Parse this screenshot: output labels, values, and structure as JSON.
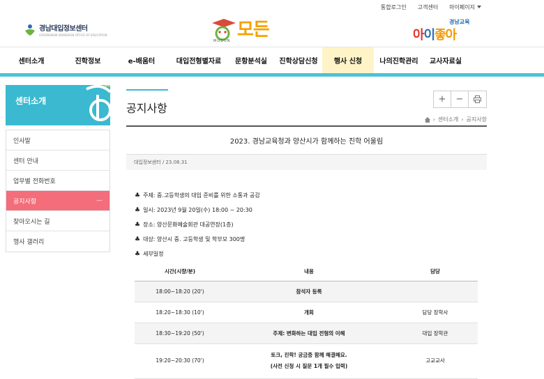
{
  "topbar": {
    "links": [
      "통합로그인",
      "고객센터",
      "마이페이지"
    ]
  },
  "header": {
    "left_logo": {
      "name": "경남대입정보센터",
      "sub": "GYEONGNAM ADMISSION OFFICE OF EDUCATION"
    },
    "center_logo": {
      "brand": "모든",
      "en": "MODUN"
    },
    "right_logo": {
      "small": "경남교육",
      "big_1": "아",
      "big_2": "이",
      "big_3": "좋아"
    }
  },
  "nav": {
    "items": [
      "센터소개",
      "진학정보",
      "e-배움터",
      "대입전형별자료",
      "문항분석실",
      "진학상담신청",
      "행사 신청",
      "나의진학관리",
      "교사자료실"
    ],
    "active_index": 6
  },
  "sidebar": {
    "title": "센터소개",
    "items": [
      "인사말",
      "센터 안내",
      "업무별 전화번호",
      "공지사항",
      "찾아오시는 길",
      "행사 갤러리"
    ],
    "active_index": 3,
    "active_marker": "—"
  },
  "page": {
    "title": "공지사항",
    "tools": [
      "+",
      "−",
      "⎙"
    ],
    "breadcrumb": [
      "센터소개",
      "공지사항"
    ]
  },
  "post": {
    "title": "2023. 경남교육청과 양산시가 함께하는 진학 어울림",
    "meta": "대입정보센터 / 23.08.31",
    "lines": [
      "주제: 중.고등학생의 대입 준비를 위한 소통과 공감",
      "일시: 2023년 9월 20일(수) 18:00 ~ 20:30",
      "장소: 양산문화예술회관 대공연장(1층)",
      "대상: 양산시 중. 고등학생 및 학부모 300명",
      "세부일정"
    ],
    "bullet": "♣"
  },
  "schedule": {
    "headers": [
      "시간(시량/분)",
      "내용",
      "담당"
    ],
    "rows": [
      {
        "time": "18:00~18:20 (20')",
        "content": "참석자 등록",
        "owner": ""
      },
      {
        "time": "18:20~18:30 (10')",
        "content": "개회",
        "owner": "담당 장학사"
      },
      {
        "time": "18:30~19:20 (50')",
        "content": "주제: 변화하는 대입 전형의 이해",
        "owner": "대입 장학관"
      },
      {
        "time": "19:20~20:30 (70')",
        "content": "토크, 진학! 궁금증 함께 해결해요.",
        "content2": "(사전 신청 시 질문 1개 필수 입력)",
        "owner": "고교교사"
      }
    ]
  },
  "colors": {
    "accent": "#3ab9d0",
    "active_side": "#f36d7a",
    "active_nav": "#fff4c8"
  }
}
